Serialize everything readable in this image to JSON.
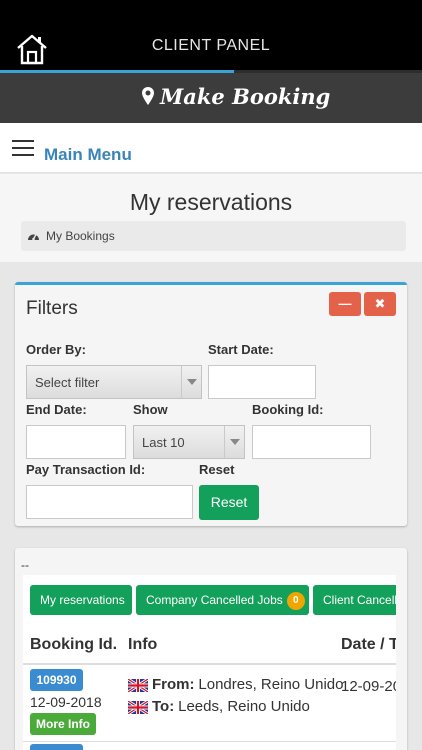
{
  "header": {
    "title": "CLIENT PANEL",
    "home_icon": "home-icon",
    "progress_fraction": 0.555
  },
  "booking_bar": {
    "label": "Make Booking",
    "icon": "map-pin-icon"
  },
  "menu": {
    "label": "Main Menu",
    "icon": "hamburger-icon"
  },
  "page": {
    "title": "My reservations",
    "breadcrumb": "My Bookings",
    "breadcrumb_icon": "dashboard-icon"
  },
  "filters": {
    "title": "Filters",
    "minimize_icon": "minus-icon",
    "close_icon": "close-icon",
    "order_by_label": "Order By:",
    "order_by_value": "Select filter",
    "start_date_label": "Start Date:",
    "start_date_value": "",
    "end_date_label": "End Date:",
    "end_date_value": "",
    "show_label": "Show",
    "show_value": "Last 10",
    "booking_id_label": "Booking Id:",
    "booking_id_value": "",
    "pay_tx_label": "Pay Transaction Id:",
    "pay_tx_value": "",
    "reset_label": "Reset",
    "reset_button": "Reset"
  },
  "results": {
    "separator": "--",
    "tabs": [
      {
        "label": "My reservations"
      },
      {
        "label": "Company Cancelled Jobs",
        "count": "0"
      },
      {
        "label": "Client Cancelle"
      }
    ],
    "columns": [
      "Booking Id.",
      "Info",
      "Date / T"
    ],
    "rows": [
      {
        "id": "109930",
        "date": "12-09-2018",
        "more": "More Info",
        "from_label": "From:",
        "from": "Londres, Reino Unido",
        "to_label": "To:",
        "to": "Leeds, Reino Unido",
        "datetime": "12-09-20"
      }
    ]
  },
  "colors": {
    "accent_blue": "#3aa3d6",
    "link_blue": "#3a84b8",
    "green": "#13a05a",
    "red": "#e5624a",
    "orange": "#f0a500",
    "id_blue": "#3a8bd0"
  }
}
